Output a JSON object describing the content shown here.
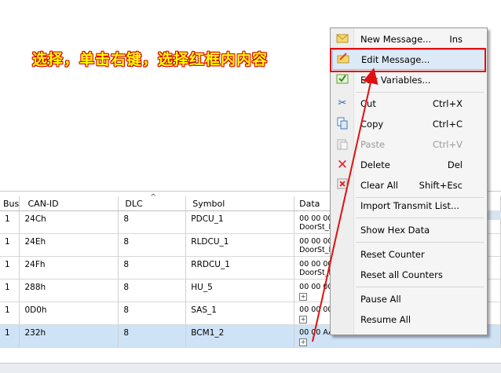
{
  "annotation": "选择，单击右键，选择红框内内容",
  "table": {
    "columns": [
      "Bus",
      "CAN-ID",
      "DLC",
      "Symbol",
      "Data"
    ],
    "rows": [
      {
        "bus": "1",
        "id": "24Ch",
        "dlc": "8",
        "symbol": "PDCU_1",
        "data1": "00 00 00",
        "data2": "DoorSt_F",
        "selected": false
      },
      {
        "bus": "1",
        "id": "24Eh",
        "dlc": "8",
        "symbol": "RLDCU_1",
        "data1": "00 00 00",
        "data2": "DoorSt_F",
        "selected": false
      },
      {
        "bus": "1",
        "id": "24Fh",
        "dlc": "8",
        "symbol": "RRDCU_1",
        "data1": "00 00 00",
        "data2": "DoorSt_F",
        "selected": false
      },
      {
        "bus": "1",
        "id": "288h",
        "dlc": "8",
        "symbol": "HU_5",
        "data1": "00 00 00",
        "data2": "",
        "selected": false
      },
      {
        "bus": "1",
        "id": "0D0h",
        "dlc": "8",
        "symbol": "SAS_1",
        "data1": "00 00 00",
        "data2": "",
        "selected": false
      },
      {
        "bus": "1",
        "id": "232h",
        "dlc": "8",
        "symbol": "BCM1_2",
        "data1": "00 00 AA 00 00 00 04 00",
        "data2": "",
        "selected": true
      }
    ]
  },
  "context_menu": {
    "items": [
      {
        "label": "New Message...",
        "shortcut": "Ins",
        "icon": "envelope-icon",
        "disabled": false
      },
      {
        "label": "Edit Message...",
        "shortcut": "",
        "icon": "edit-message-icon",
        "disabled": false,
        "highlighted": true
      },
      {
        "label": "Edit Variables...",
        "shortcut": "",
        "icon": "edit-variables-icon",
        "disabled": false
      },
      {
        "label": "Cut",
        "shortcut": "Ctrl+X",
        "icon": "scissors-icon",
        "disabled": false
      },
      {
        "label": "Copy",
        "shortcut": "Ctrl+C",
        "icon": "copy-icon",
        "disabled": false
      },
      {
        "label": "Paste",
        "shortcut": "Ctrl+V",
        "icon": "paste-icon",
        "disabled": true
      },
      {
        "label": "Delete",
        "shortcut": "Del",
        "icon": "delete-x-icon",
        "disabled": false
      },
      {
        "label": "Clear All",
        "shortcut": "Shift+Esc",
        "icon": "clear-all-icon",
        "disabled": false
      },
      {
        "label": "Import Transmit List...",
        "shortcut": "",
        "icon": "",
        "disabled": false
      },
      {
        "label": "Show Hex Data",
        "shortcut": "",
        "icon": "",
        "disabled": false
      },
      {
        "label": "Reset Counter",
        "shortcut": "",
        "icon": "",
        "disabled": false
      },
      {
        "label": "Reset all Counters",
        "shortcut": "",
        "icon": "",
        "disabled": false
      },
      {
        "label": "Pause All",
        "shortcut": "",
        "icon": "",
        "disabled": false
      },
      {
        "label": "Resume All",
        "shortcut": "",
        "icon": "",
        "disabled": false
      }
    ]
  },
  "colors": {
    "annotation_text": "#ffff00",
    "annotation_outline": "#d40000",
    "highlight_box": "#e01010",
    "selected_row": "#cfe3f7"
  }
}
